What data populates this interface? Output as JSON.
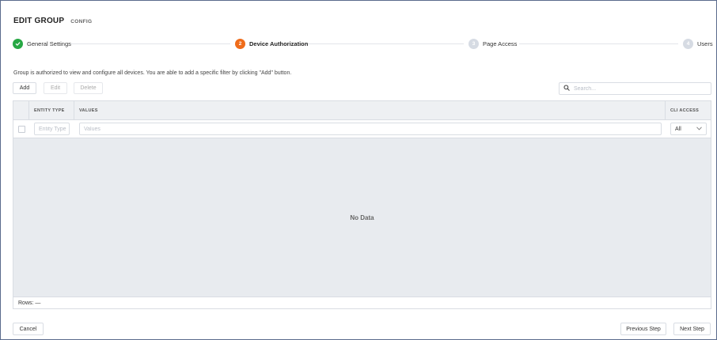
{
  "header": {
    "title": "EDIT GROUP",
    "subtitle": "CONFIG"
  },
  "steps": [
    {
      "label": "General Settings",
      "number": "",
      "state": "done"
    },
    {
      "label": "Device Authorization",
      "number": "2",
      "state": "active"
    },
    {
      "label": "Page Access",
      "number": "3",
      "state": "todo"
    },
    {
      "label": "Users",
      "number": "4",
      "state": "todo"
    }
  ],
  "description": "Group is authorized to view and configure all devices. You are able to add a specific filter by clicking \"Add\" button.",
  "toolbar": {
    "add_label": "Add",
    "edit_label": "Edit",
    "delete_label": "Delete"
  },
  "search": {
    "placeholder": "Search..."
  },
  "table": {
    "columns": [
      "ENTITY TYPE",
      "VALUES",
      "CLI ACCESS"
    ],
    "filters": {
      "entity_type_placeholder": "Entity Type",
      "values_placeholder": "Values",
      "cli_access_value": "All"
    },
    "empty_text": "No Data",
    "rows_label": "Rows: —"
  },
  "footer": {
    "cancel_label": "Cancel",
    "previous_label": "Previous Step",
    "next_label": "Next Step"
  },
  "colors": {
    "done": "#27a844",
    "active": "#ef6c1a",
    "todo": "#d6dbe3",
    "border": "#5a6b8c"
  }
}
